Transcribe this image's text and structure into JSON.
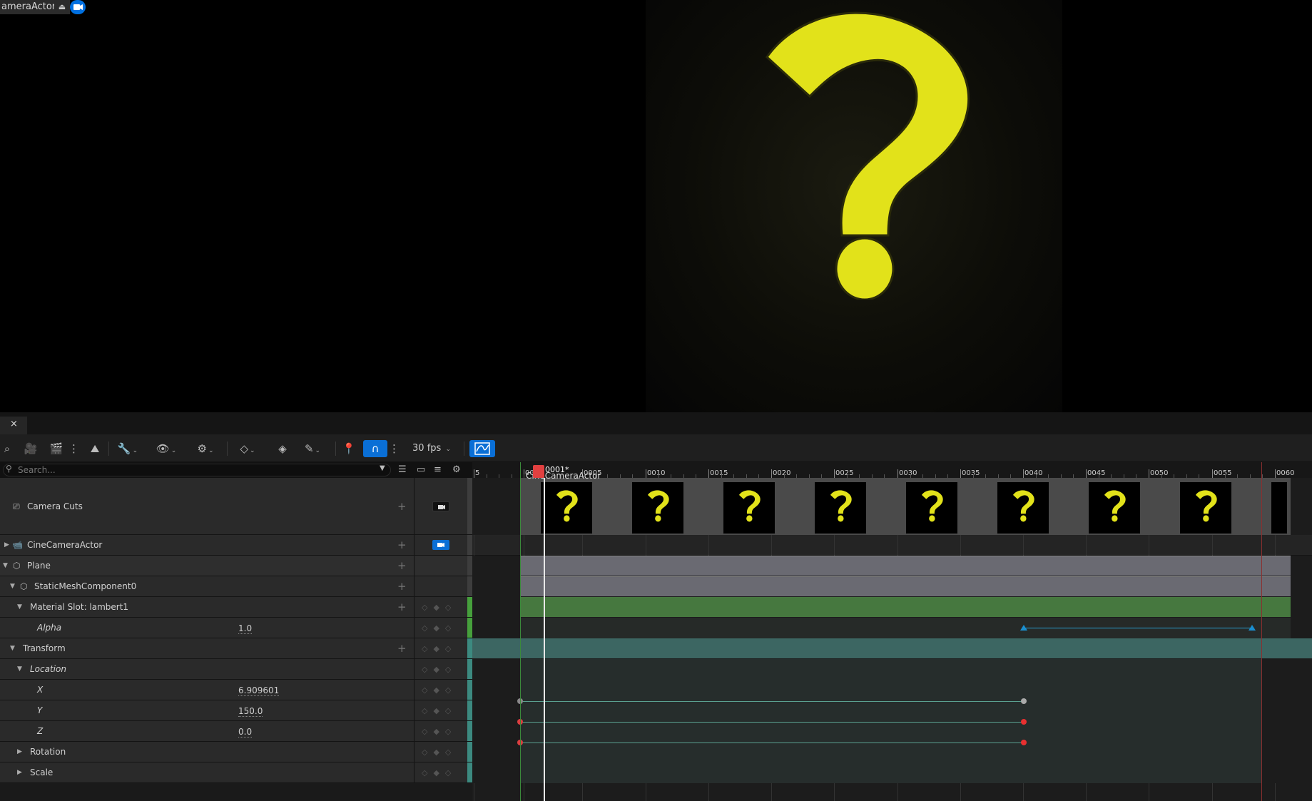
{
  "viewport": {
    "camera_label": "ameraActor",
    "eject_glyph": "⏏"
  },
  "tab": {
    "close_glyph": "×"
  },
  "toolbar": {
    "fps_label": "30 fps",
    "caret": "⌄"
  },
  "search": {
    "placeholder": "Search..."
  },
  "tracks": {
    "camera_cuts": "Camera Cuts",
    "cine_camera": "CineCameraActor",
    "plane": "Plane",
    "static_mesh": "StaticMeshComponent0",
    "material_slot": "Material Slot: lambert1",
    "alpha": "Alpha",
    "alpha_value": "1.0",
    "transform": "Transform",
    "location": "Location",
    "x": "X",
    "x_value": "6.909601",
    "y": "Y",
    "y_value": "150.0",
    "z": "Z",
    "z_value": "0.0",
    "rotation": "Rotation",
    "scale": "Scale"
  },
  "timeline": {
    "current_frame": "0001*",
    "shot_label": "CineCameraActor",
    "ticks": [
      "5",
      "00",
      "0005",
      "0010",
      "0015",
      "0020",
      "0025",
      "0030",
      "0035",
      "0040",
      "0045",
      "0050",
      "0055",
      "0060"
    ]
  },
  "colors": {
    "accent": "#0a6fd6",
    "playhead": "#e14040",
    "material_track": "#46783f",
    "transform_track": "#3c6662",
    "plane_track": "#6a6a72",
    "qmark": "#e2e21a"
  }
}
